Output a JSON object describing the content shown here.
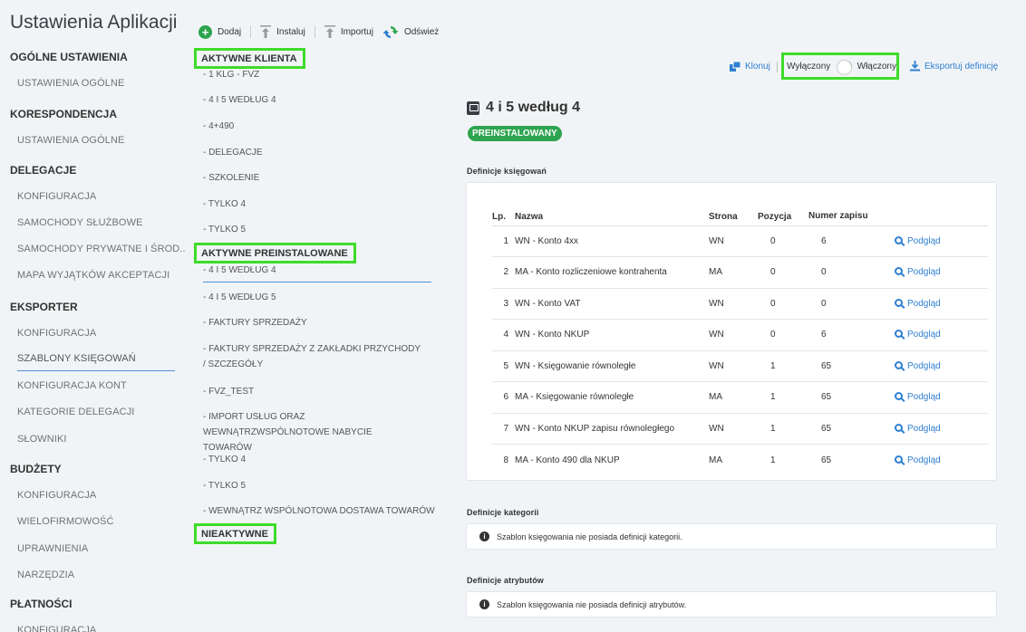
{
  "app": {
    "title": "Ustawienia Aplikacji"
  },
  "nav": {
    "sections": [
      {
        "label": "OGÓLNE USTAWIENIA",
        "items": [
          "USTAWIENIA OGÓLNE"
        ]
      },
      {
        "label": "KORESPONDENCJA",
        "items": [
          "USTAWIENIA OGÓLNE"
        ]
      },
      {
        "label": "DELEGACJE",
        "items": [
          "KONFIGURACJA",
          "SAMOCHODY SŁUŻBOWE",
          "SAMOCHODY PRYWATNE I ŚROD...",
          "MAPA WYJĄTKÓW AKCEPTACJI"
        ]
      },
      {
        "label": "EKSPORTER",
        "items": [
          "KONFIGURACJA",
          "SZABLONY KSIĘGOWAŃ",
          "KONFIGURACJA KONT",
          "KATEGORIE DELEGACJI",
          "SŁOWNIKI"
        ]
      },
      {
        "label": "BUDŻETY",
        "items": [
          "KONFIGURACJA",
          "WIELOFIRMOWOŚĆ",
          "UPRAWNIENIA",
          "NARZĘDZIA"
        ]
      },
      {
        "label": "PŁATNOŚCI",
        "items": [
          "KONFIGURACJA"
        ]
      }
    ],
    "active_item": "SZABLONY KSIĘGOWAŃ"
  },
  "toolbar": {
    "add": "Dodaj",
    "install": "Instaluj",
    "import": "Importuj",
    "refresh": "Odśwież"
  },
  "templates": {
    "groups": [
      {
        "label": "AKTYWNE KLIENTA",
        "items": [
          "- 1 KLG - FVZ",
          "- 4 I 5 WEDŁUG 4",
          "- 4+490",
          "- DELEGACJE",
          "- SZKOLENIE",
          "- TYLKO 4",
          "- TYLKO 5"
        ]
      },
      {
        "label": "AKTYWNE PREINSTALOWANE",
        "items": [
          "- 4 I 5 WEDŁUG 4",
          "- 4 I 5 WEDŁUG 5",
          "- FAKTURY SPRZEDAŻY",
          "- FAKTURY SPRZEDAŻY Z ZAKŁADKI PRZYCHODY / SZCZEGÓŁY",
          "- FVZ_TEST",
          "- IMPORT USŁUG ORAZ WEWNĄTRZWSPÓLNOTOWE NABYCIE TOWARÓW",
          "- TYLKO 4",
          "- TYLKO 5",
          "- WEWNĄTRZ WSPÓLNOTOWA DOSTAWA TOWARÓW"
        ]
      },
      {
        "label": "NIEAKTYWNE",
        "items": []
      }
    ]
  },
  "actions": {
    "clone": "Klonuj",
    "off_label": "Wyłączony",
    "on_label": "Włączony",
    "toggle_state": "on",
    "export": "Eksportuj definicję"
  },
  "detail": {
    "title": "4 i 5 według 4",
    "badge": "PREINSTALOWANY",
    "definitions_label": "Definicje księgowań",
    "columns": {
      "lp": "Lp.",
      "name": "Nazwa",
      "side": "Strona",
      "position": "Pozycja",
      "record_no": "Numer zapisu"
    },
    "rows": [
      {
        "lp": "1",
        "name": "WN - Konto 4xx",
        "side": "WN",
        "position": "0",
        "record": "6",
        "preview": "Podgląd"
      },
      {
        "lp": "2",
        "name": "MA - Konto rozliczeniowe kontrahenta",
        "side": "MA",
        "position": "0",
        "record": "0",
        "preview": "Podgląd"
      },
      {
        "lp": "3",
        "name": "WN - Konto VAT",
        "side": "WN",
        "position": "0",
        "record": "0",
        "preview": "Podgląd"
      },
      {
        "lp": "4",
        "name": "WN - Konto NKUP",
        "side": "WN",
        "position": "0",
        "record": "6",
        "preview": "Podgląd"
      },
      {
        "lp": "5",
        "name": "WN - Księgowanie równoległe",
        "side": "WN",
        "position": "1",
        "record": "65",
        "preview": "Podgląd"
      },
      {
        "lp": "6",
        "name": "MA - Księgowanie równoległe",
        "side": "MA",
        "position": "1",
        "record": "65",
        "preview": "Podgląd"
      },
      {
        "lp": "7",
        "name": "WN - Konto NKUP zapisu równoległego",
        "side": "WN",
        "position": "1",
        "record": "65",
        "preview": "Podgląd"
      },
      {
        "lp": "8",
        "name": "MA - Konto 490 dla NKUP",
        "side": "MA",
        "position": "1",
        "record": "65",
        "preview": "Podgląd"
      }
    ],
    "category_label": "Definicje kategorii",
    "category_info": "Szablon księgowania nie posiada definicji kategorii.",
    "attribute_label": "Definicje atrybutów",
    "attribute_info": "Szablon księgowania nie posiada definicji atrybutów."
  },
  "colors": {
    "accent": "#2f7fd1",
    "success": "#2ea44f",
    "highlight": "#3ddc2a"
  }
}
